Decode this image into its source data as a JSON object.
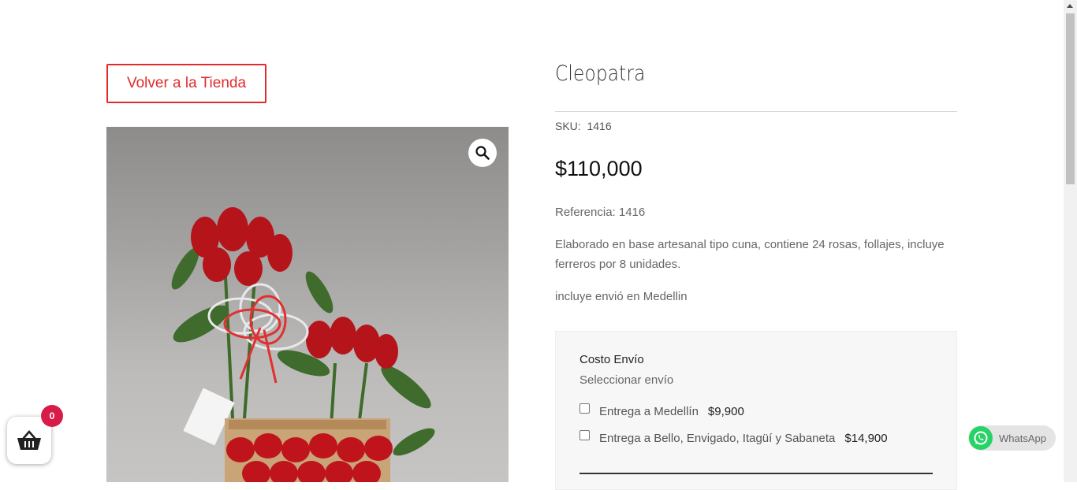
{
  "back_button": {
    "label": "Volver a la Tienda"
  },
  "product": {
    "title": "Cleopatra",
    "sku_label": "SKU:",
    "sku_value": "1416",
    "price": "$110,000",
    "reference": "Referencia: 1416",
    "description": "Elaborado en base artesanal tipo cuna, contiene 24 rosas, follajes, incluye ferreros por 8 unidades.",
    "shipping_note": "incluye envió en Medellin"
  },
  "shipping": {
    "title": "Costo Envío",
    "subtitle": "Seleccionar envío",
    "options": [
      {
        "label": "Entrega a Medellín",
        "price": "$9,900"
      },
      {
        "label": "Entrega a Bello, Envigado, Itagüí y Sabaneta",
        "price": "$14,900"
      }
    ]
  },
  "cart": {
    "count": "0",
    "icon": "basket-icon"
  },
  "whatsapp": {
    "label": "WhatsApp",
    "icon": "whatsapp-icon"
  },
  "colors": {
    "accent": "#e12b2b",
    "badge": "#d81b47",
    "whatsapp": "#25d366"
  }
}
